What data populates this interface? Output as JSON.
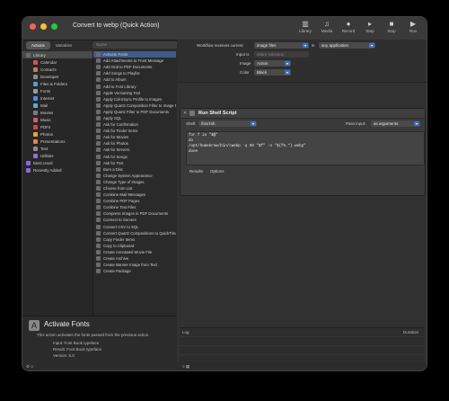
{
  "window": {
    "title": "Convert to webp (Quick Action)"
  },
  "traffic_colors": [
    "#ff5f57",
    "#febc2e",
    "#28c840"
  ],
  "toolbar": [
    {
      "icon": "library-icon",
      "glyph": "▥",
      "label": "Library"
    },
    {
      "icon": "media-icon",
      "glyph": "♫",
      "label": "Media"
    },
    {
      "icon": "record-icon",
      "glyph": "●",
      "label": "Record"
    },
    {
      "icon": "step-icon",
      "glyph": "▸",
      "label": "Step"
    },
    {
      "icon": "stop-icon",
      "glyph": "■",
      "label": "Stop"
    },
    {
      "icon": "run-icon",
      "glyph": "▶",
      "label": "Run"
    }
  ],
  "segments": [
    "Actions",
    "Variables"
  ],
  "search_placeholder": "Name",
  "library": [
    {
      "label": "Library",
      "color": "#6b6b6b",
      "indent": 0,
      "selected": true
    },
    {
      "label": "Calendar",
      "color": "#d9534f",
      "indent": 1
    },
    {
      "label": "Contacts",
      "color": "#b5835a",
      "indent": 1
    },
    {
      "label": "Developer",
      "color": "#8a8a8a",
      "indent": 1
    },
    {
      "label": "Files & Folders",
      "color": "#5b9bd5",
      "indent": 1
    },
    {
      "label": "Fonts",
      "color": "#9a9a9a",
      "indent": 1
    },
    {
      "label": "Internet",
      "color": "#4a90e2",
      "indent": 1
    },
    {
      "label": "Mail",
      "color": "#5fa8e0",
      "indent": 1
    },
    {
      "label": "Movies",
      "color": "#7a7a7a",
      "indent": 1
    },
    {
      "label": "Music",
      "color": "#e2566f",
      "indent": 1
    },
    {
      "label": "PDFs",
      "color": "#d04a3b",
      "indent": 1
    },
    {
      "label": "Photos",
      "color": "#e8a23a",
      "indent": 1
    },
    {
      "label": "Presentations",
      "color": "#e0853a",
      "indent": 1
    },
    {
      "label": "Text",
      "color": "#8d8d8d",
      "indent": 1
    },
    {
      "label": "Utilities",
      "color": "#9b6bd6",
      "indent": 1
    },
    {
      "label": "Most Used",
      "color": "#8a6bd6",
      "indent": 0
    },
    {
      "label": "Recently Added",
      "color": "#8a6bd6",
      "indent": 0
    }
  ],
  "actions": [
    "Activate Fonts",
    "Add Attachments to Front Message",
    "Add Grid to PDF Documents",
    "Add Songs to Playlist",
    "Add to Album",
    "Add to Font Library",
    "Apple Versioning Tool",
    "Apply ColorSync Profile to Images",
    "Apply Quartz Composition Filter to Image Files",
    "Apply Quartz Filter to PDF Documents",
    "Apply SQL",
    "Ask for Confirmation",
    "Ask for Finder Items",
    "Ask for Movies",
    "Ask for Photos",
    "Ask for Servers",
    "Ask for Songs",
    "Ask for Text",
    "Burn a Disc",
    "Change System Appearance",
    "Change Type of Images",
    "Choose from List",
    "Combine Mail Messages",
    "Combine PDF Pages",
    "Combine Text Files",
    "Compress Images in PDF Documents",
    "Connect to Servers",
    "Convert CSV to SQL",
    "Convert Quartz Compositions to QuickTime Movies",
    "Copy Finder Items",
    "Copy to Clipboard",
    "Create Annotated Movie File",
    "Create Archive",
    "Create Banner Image from Text",
    "Create Package"
  ],
  "info": {
    "title": "Activate Fonts",
    "description": "This action activates the fonts passed from the previous action.",
    "meta": [
      "Input: Font Book typeface",
      "Result: Font Book typeface",
      "Version: 5.0"
    ]
  },
  "workflow": {
    "receives_label": "Workflow receives current",
    "receives_value": "image files",
    "in_label": "in",
    "in_value": "any application",
    "input_label": "Input is",
    "input_value": "entire selection",
    "image_label": "Image",
    "image_value": "Action",
    "color_label": "Color",
    "color_value": "Black"
  },
  "action_card": {
    "title": "Run Shell Script",
    "shell_label": "Shell:",
    "shell_value": "/bin/zsh",
    "pass_label": "Pass input:",
    "pass_value": "as arguments",
    "code": [
      "for f in \"$@\"",
      "do",
      "  /opt/homebrew/bin/cwebp -q 85 \"$f\" -o \"${f%.*}.webp\"",
      "done"
    ],
    "tabs": [
      "Results",
      "Options"
    ]
  },
  "log": {
    "col1": "Log",
    "col2": "Duration"
  },
  "status_bottom_left": "⚙ ≡",
  "status_bottom_right": "≡ ▦"
}
